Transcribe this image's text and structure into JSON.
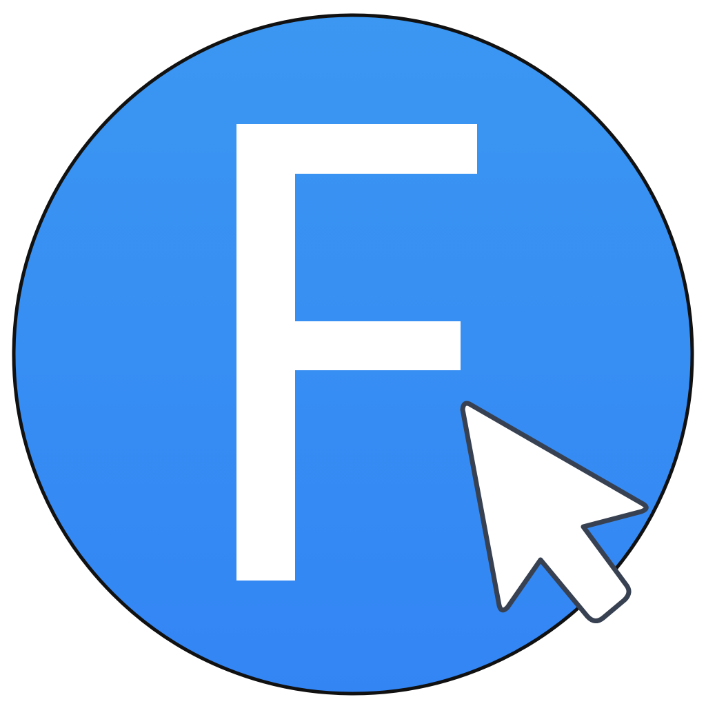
{
  "logo": {
    "letter": "F",
    "icons": {
      "badge": "circle-badge-icon",
      "letter": "letter-f-icon",
      "cursor": "mouse-pointer-icon"
    },
    "colors": {
      "badge_fill_top": "#3b97f2",
      "badge_fill_bottom": "#3385f4",
      "badge_outline": "#111111",
      "letter": "#ffffff",
      "cursor_fill": "#ffffff",
      "cursor_outline": "#374151"
    }
  }
}
